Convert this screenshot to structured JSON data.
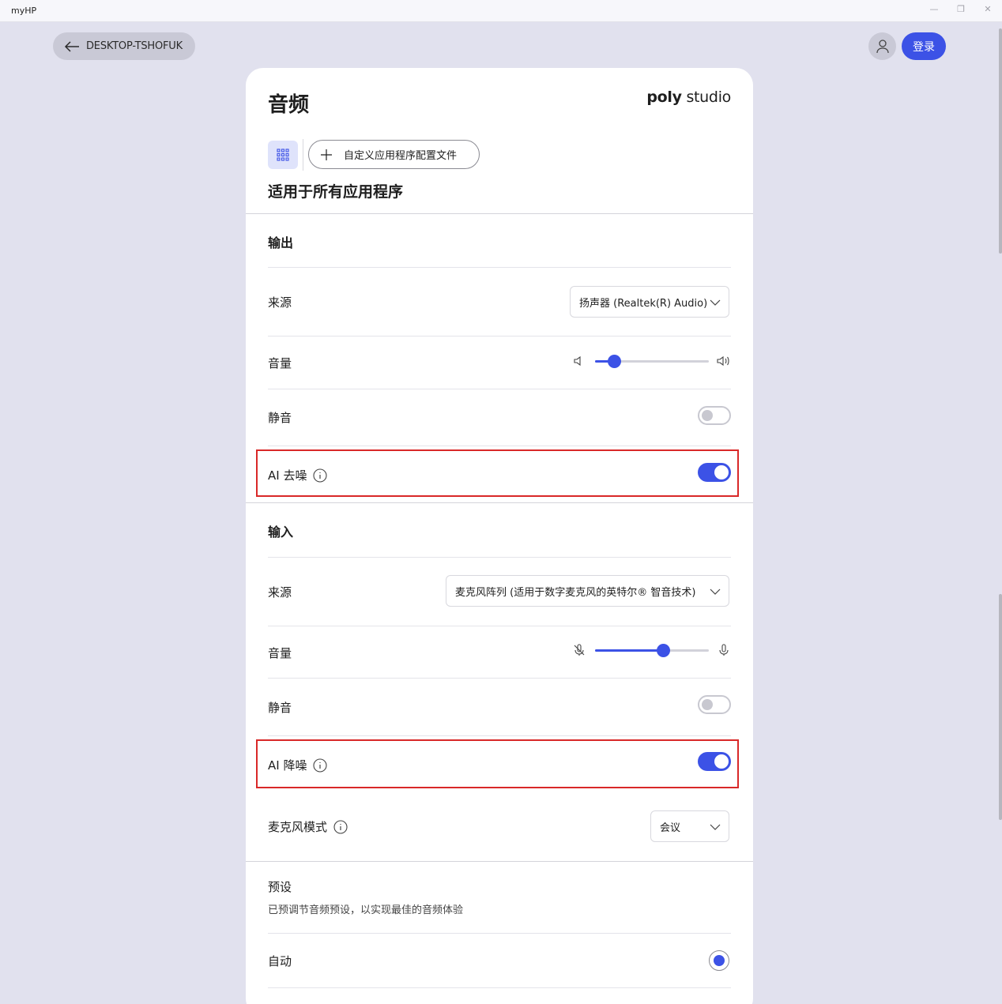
{
  "window": {
    "title": "myHP",
    "minimize": "—",
    "maximize": "❐",
    "close": "✕"
  },
  "header": {
    "back_label": "DESKTOP-TSHOFUK",
    "login_label": "登录"
  },
  "card": {
    "title": "音频",
    "brand_bold": "poly",
    "brand_light": "studio",
    "custom_profile_label": "自定义应用程序配置文件",
    "subtitle": "适用于所有应用程序"
  },
  "output": {
    "title": "输出",
    "source_label": "来源",
    "source_value": "扬声器 (Realtek(R) Audio)",
    "volume_label": "音量",
    "volume_level": 0.17,
    "mute_label": "静音",
    "mute_on": false,
    "ai_label": "AI 去噪",
    "ai_on": true
  },
  "input": {
    "title": "输入",
    "source_label": "来源",
    "source_value": "麦克风阵列 (适用于数字麦克风的英特尔® 智音技术)",
    "volume_label": "音量",
    "volume_level": 0.6,
    "mute_label": "静音",
    "mute_on": false,
    "ai_label": "AI 降噪",
    "ai_on": true,
    "mic_mode_label": "麦克风模式",
    "mic_mode_value": "会议"
  },
  "presets": {
    "title": "预设",
    "description": "已预调节音频预设，以实现最佳的音频体验",
    "items": [
      {
        "label": "自动",
        "selected": true
      }
    ]
  },
  "colors": {
    "accent": "#3c52e6",
    "highlight": "#d92828",
    "background": "#e1e1ee"
  }
}
